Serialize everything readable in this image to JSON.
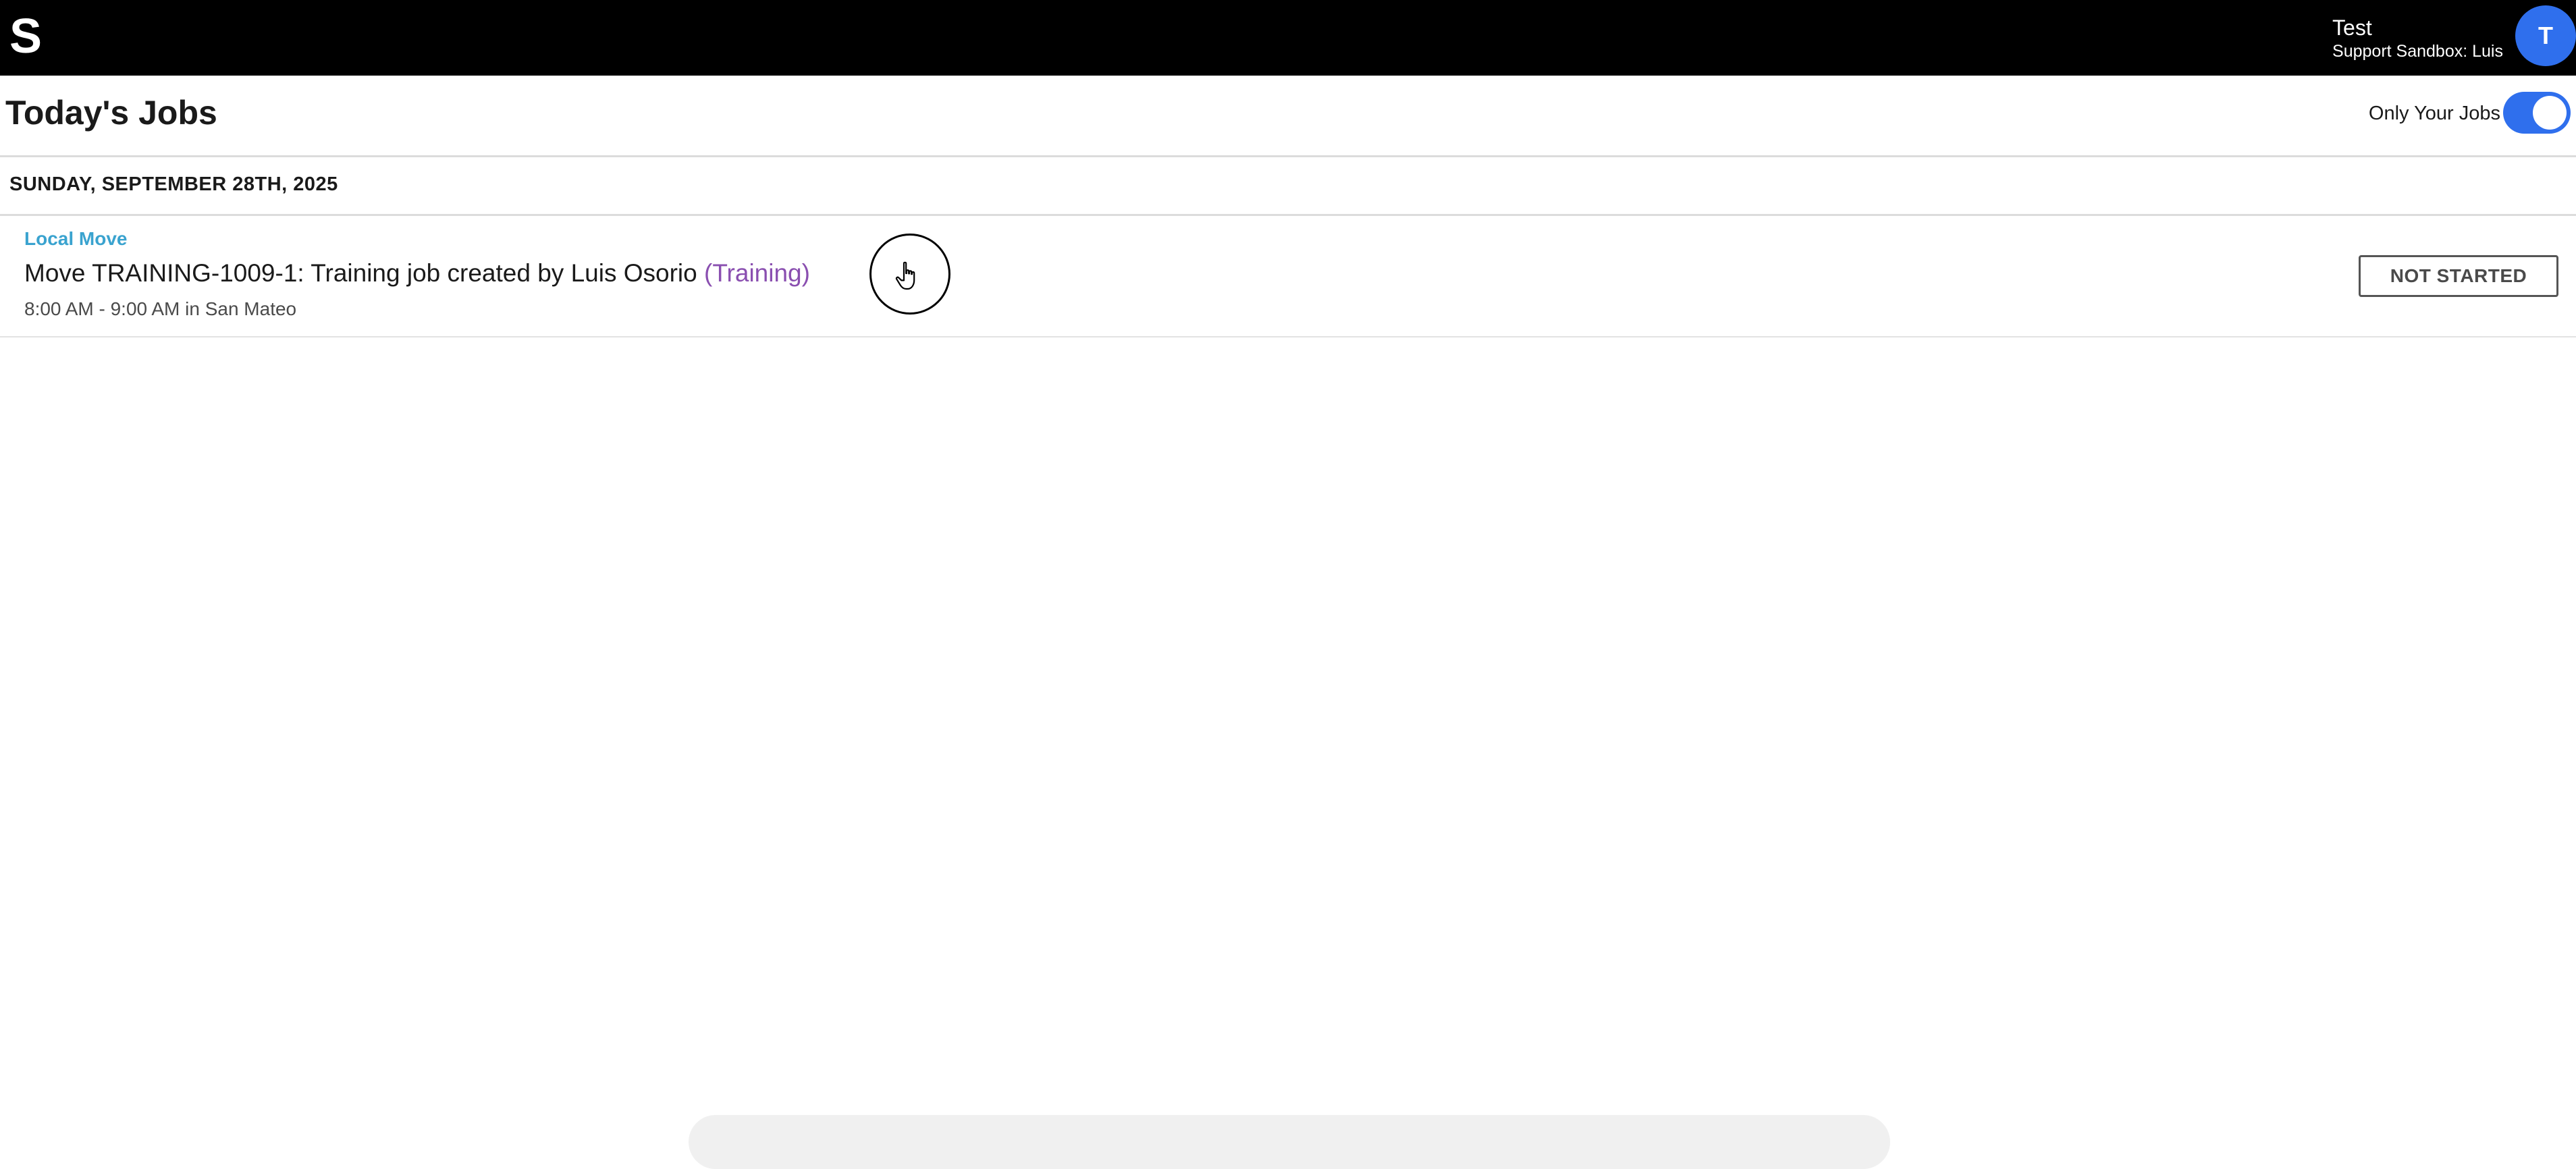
{
  "app": {
    "logo_text": "S"
  },
  "user": {
    "name": "Test",
    "org": "Support Sandbox: Luis",
    "avatar_initial": "T"
  },
  "header": {
    "title": "Today's Jobs",
    "toggle_label": "Only Your Jobs",
    "toggle_on": true
  },
  "date_group": {
    "label": "SUNDAY, SEPTEMBER 28TH, 2025"
  },
  "jobs": [
    {
      "type": "Local Move",
      "title": "Move TRAINING-1009-1: Training job created by Luis Osorio",
      "tag": "(Training)",
      "time": "8:00 AM - 9:00 AM in San Mateo",
      "status": "NOT STARTED"
    }
  ],
  "colors": {
    "topbar": "#000000",
    "accent_blue": "#2f6fed",
    "job_type": "#3aa3cf",
    "training_tag": "#8a4fb0"
  },
  "icons": {
    "cursor": "pointer-hand-icon"
  }
}
